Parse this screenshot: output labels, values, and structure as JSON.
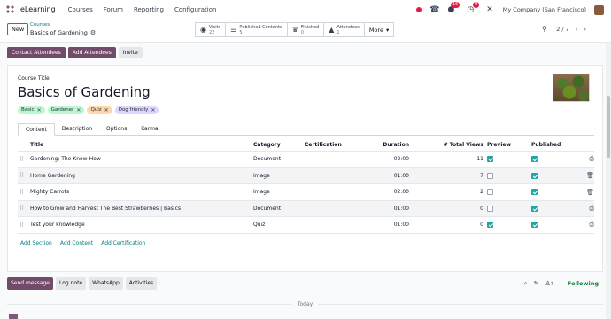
{
  "navbar": {
    "app_name": "eLearning",
    "menu": [
      "Courses",
      "Forum",
      "Reporting",
      "Configuration"
    ],
    "chat_badge": "15",
    "activity_badge": "9",
    "company": "My Company (San Francisco)"
  },
  "control_panel": {
    "new_label": "New",
    "breadcrumb_parent": "Courses",
    "breadcrumb_current": "Basics of Gardening",
    "smart_buttons": [
      {
        "label": "Visits",
        "value": "22",
        "icon": "eye-icon"
      },
      {
        "label": "Published Contents",
        "value": "5",
        "icon": "list-icon"
      },
      {
        "label": "Finished",
        "value": "0",
        "icon": "trophy-icon"
      },
      {
        "label": "Attendees",
        "value": "1",
        "icon": "graduation-cap-icon"
      }
    ],
    "more_label": "More",
    "pager": "2 / 7"
  },
  "actions": {
    "contact_attendees": "Contact Attendees",
    "add_attendees": "Add Attendees",
    "invite": "Invite"
  },
  "form": {
    "course_title_label": "Course Title",
    "course_title": "Basics of Gardening",
    "tags": [
      {
        "label": "Basic",
        "color": "#bbf7d0"
      },
      {
        "label": "Gardener",
        "color": "#bbf7d0"
      },
      {
        "label": "Quiz",
        "color": "#fed7aa"
      },
      {
        "label": "Dog friendly",
        "color": "#ddd6fe"
      }
    ],
    "tabs": [
      "Content",
      "Description",
      "Options",
      "Karma"
    ],
    "columns": {
      "title": "Title",
      "category": "Category",
      "certification": "Certification",
      "duration": "Duration",
      "views": "# Total Views",
      "preview": "Preview",
      "published": "Published"
    },
    "rows": [
      {
        "title": "Gardening: The Know-How",
        "category": "Document",
        "duration": "02:00",
        "views": "11",
        "preview": true,
        "published": true,
        "action_icon": "print-icon"
      },
      {
        "title": "Home Gardening",
        "category": "Image",
        "duration": "01:00",
        "views": "7",
        "preview": false,
        "published": true,
        "action_icon": "trash-icon"
      },
      {
        "title": "Mighty Carrots",
        "category": "Image",
        "duration": "02:00",
        "views": "2",
        "preview": false,
        "published": true,
        "action_icon": "trash-icon"
      },
      {
        "title": "How to Grow and Harvest The Best Strawberries | Basics",
        "category": "Document",
        "duration": "01:00",
        "views": "0",
        "preview": false,
        "published": true,
        "action_icon": "print-icon"
      },
      {
        "title": "Test your knowledge",
        "category": "Quiz",
        "duration": "01:00",
        "views": "0",
        "preview": true,
        "published": true,
        "action_icon": "print-icon"
      }
    ],
    "add_links": [
      "Add Section",
      "Add Content",
      "Add Certification"
    ]
  },
  "chatter": {
    "send_message": "Send message",
    "log_note": "Log note",
    "whatsapp": "WhatsApp",
    "activities": "Activities",
    "followers_count": "7",
    "following": "Following",
    "today": "Today"
  }
}
